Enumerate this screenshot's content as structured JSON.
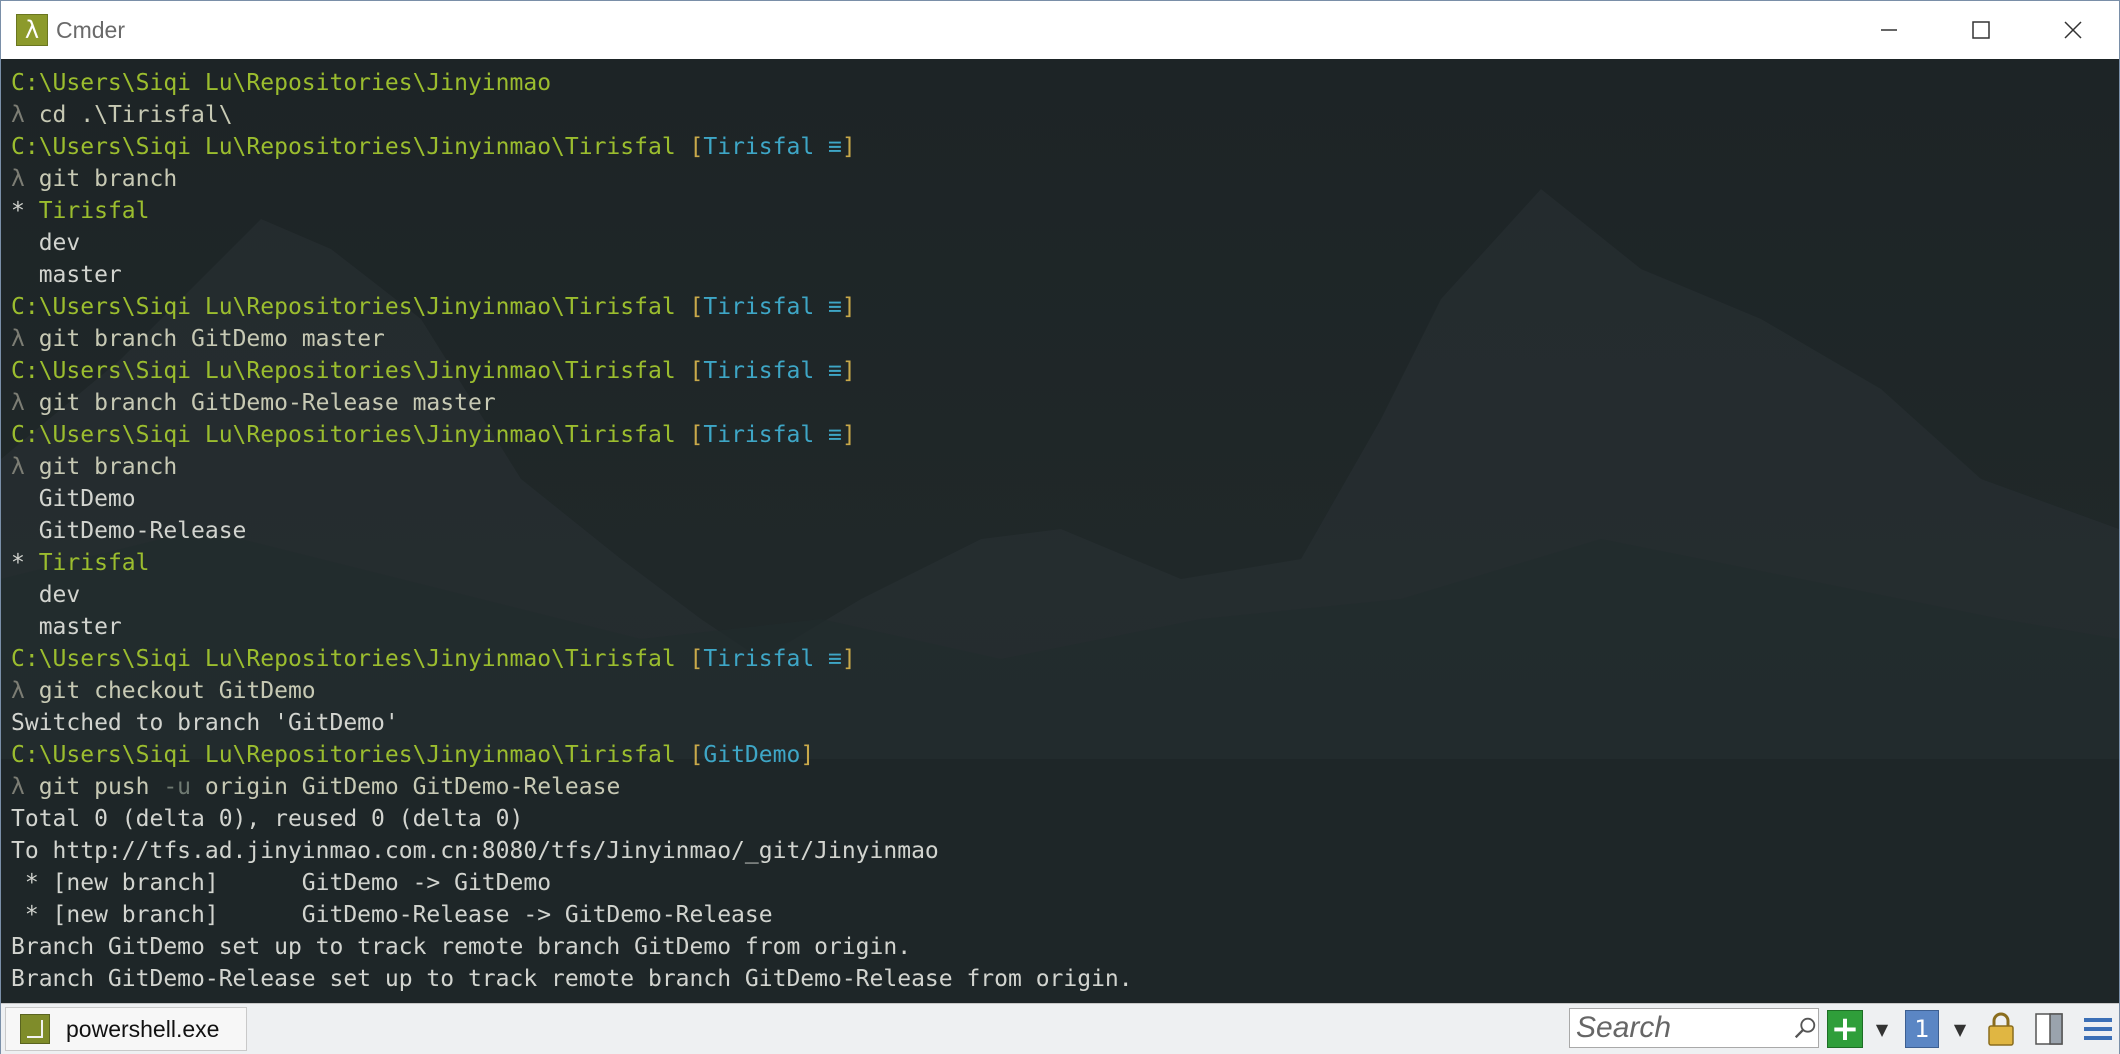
{
  "window": {
    "title": "Cmder",
    "icon": "lambda-icon"
  },
  "controls": {
    "minimize": "—",
    "maximize": "☐",
    "close": "✕"
  },
  "colors": {
    "path": "#9bbd2e",
    "bracket": "#c9a94a",
    "branch": "#3ea6c6",
    "lambda": "#7c7d74",
    "output": "#d2d4cf"
  },
  "terminal": {
    "lines": [
      {
        "type": "path",
        "path": "C:\\Users\\Siqi Lu\\Repositories\\Jinyinmao",
        "branch": ""
      },
      {
        "type": "cmd",
        "text": "cd .\\Tirisfal\\"
      },
      {
        "type": "path",
        "path": "C:\\Users\\Siqi Lu\\Repositories\\Jinyinmao\\Tirisfal",
        "branch": "Tirisfal ≡"
      },
      {
        "type": "cmd",
        "text": "git branch"
      },
      {
        "type": "current",
        "text": "Tirisfal"
      },
      {
        "type": "out",
        "text": "  dev"
      },
      {
        "type": "out",
        "text": "  master"
      },
      {
        "type": "path",
        "path": "C:\\Users\\Siqi Lu\\Repositories\\Jinyinmao\\Tirisfal",
        "branch": "Tirisfal ≡"
      },
      {
        "type": "cmd",
        "text": "git branch GitDemo master"
      },
      {
        "type": "path",
        "path": "C:\\Users\\Siqi Lu\\Repositories\\Jinyinmao\\Tirisfal",
        "branch": "Tirisfal ≡"
      },
      {
        "type": "cmd",
        "text": "git branch GitDemo-Release master"
      },
      {
        "type": "path",
        "path": "C:\\Users\\Siqi Lu\\Repositories\\Jinyinmao\\Tirisfal",
        "branch": "Tirisfal ≡"
      },
      {
        "type": "cmd",
        "text": "git branch"
      },
      {
        "type": "out",
        "text": "  GitDemo"
      },
      {
        "type": "out",
        "text": "  GitDemo-Release"
      },
      {
        "type": "current",
        "text": "Tirisfal"
      },
      {
        "type": "out",
        "text": "  dev"
      },
      {
        "type": "out",
        "text": "  master"
      },
      {
        "type": "path",
        "path": "C:\\Users\\Siqi Lu\\Repositories\\Jinyinmao\\Tirisfal",
        "branch": "Tirisfal ≡"
      },
      {
        "type": "cmd",
        "text": "git checkout GitDemo"
      },
      {
        "type": "out",
        "text": "Switched to branch 'GitDemo'"
      },
      {
        "type": "path",
        "path": "C:\\Users\\Siqi Lu\\Repositories\\Jinyinmao\\Tirisfal",
        "branch": "GitDemo"
      },
      {
        "type": "cmd",
        "text": "git push -u origin GitDemo GitDemo-Release"
      },
      {
        "type": "out",
        "text": "Total 0 (delta 0), reused 0 (delta 0)"
      },
      {
        "type": "out",
        "text": "To http://tfs.ad.jinyinmao.com.cn:8080/tfs/Jinyinmao/_git/Jinyinmao"
      },
      {
        "type": "out",
        "text": " * [new branch]      GitDemo -> GitDemo"
      },
      {
        "type": "out",
        "text": " * [new branch]      GitDemo-Release -> GitDemo-Release"
      },
      {
        "type": "out",
        "text": "Branch GitDemo set up to track remote branch GitDemo from origin."
      },
      {
        "type": "out",
        "text": "Branch GitDemo-Release set up to track remote branch GitDemo-Release from origin."
      }
    ]
  },
  "statusbar": {
    "tab_label": "powershell.exe",
    "tab_icon": "powershell-icon",
    "search_placeholder": "Search",
    "new_console_icon": "plus-icon",
    "console_number": "1",
    "lock_icon": "lock-icon",
    "panel_icon": "panel-icon",
    "menu_icon": "menu-icon"
  }
}
